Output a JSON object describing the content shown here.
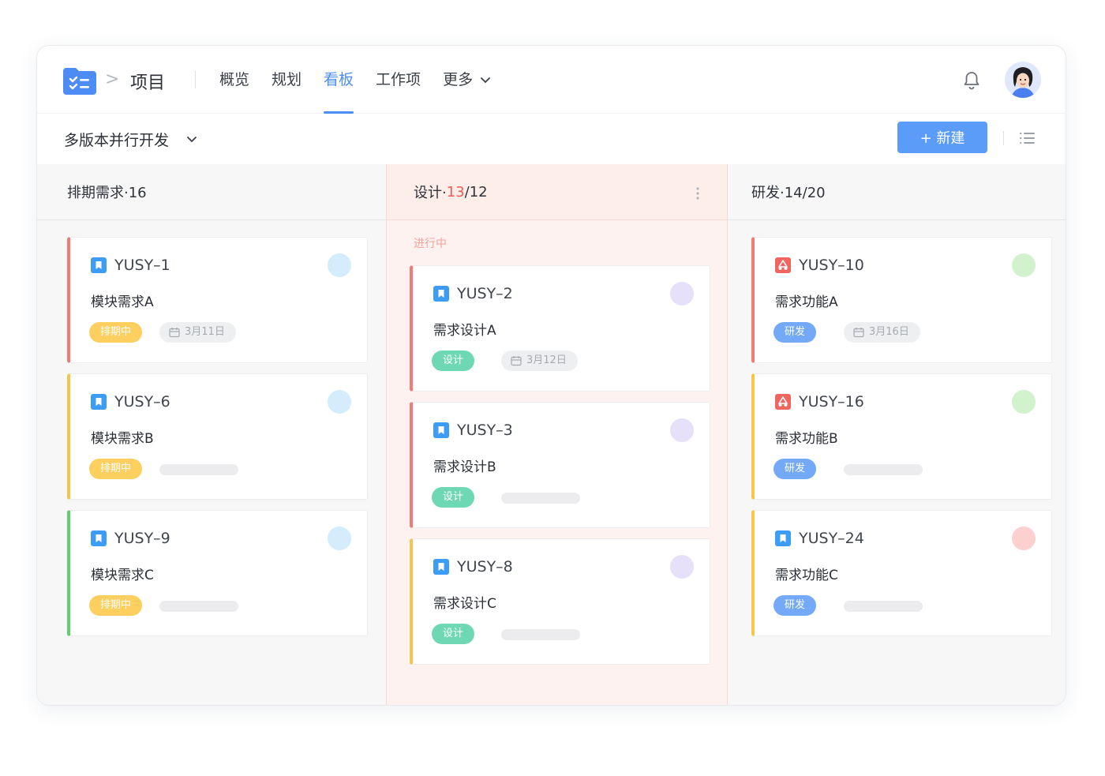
{
  "header": {
    "project_title": "项目",
    "crumb_separator": ">",
    "nav": [
      {
        "label": "概览"
      },
      {
        "label": "规划"
      },
      {
        "label": "看板"
      },
      {
        "label": "工作项"
      },
      {
        "label": "更多"
      }
    ],
    "active_nav": "看板"
  },
  "subbar": {
    "version": "多版本并行开发",
    "new_button": "+ 新建"
  },
  "columns": [
    {
      "title": "排期需求·16",
      "cards": [
        {
          "id": "YUSY–1",
          "title": "模块需求A",
          "tag": "排期中",
          "date": "3月11日"
        },
        {
          "id": "YUSY–6",
          "title": "模块需求B",
          "tag": "排期中"
        },
        {
          "id": "YUSY–9",
          "title": "模块需求C",
          "tag": "排期中"
        }
      ]
    },
    {
      "title_prefix": "设计·",
      "count_current": "13",
      "count_limit": "/12",
      "group_label": "进行中",
      "cards": [
        {
          "id": "YUSY–2",
          "title": "需求设计A",
          "tag": "设计",
          "date": "3月12日"
        },
        {
          "id": "YUSY–3",
          "title": "需求设计B",
          "tag": "设计"
        },
        {
          "id": "YUSY–8",
          "title": "需求设计C",
          "tag": "设计"
        }
      ]
    },
    {
      "title": "研发·14/20",
      "cards": [
        {
          "id": "YUSY–10",
          "title": "需求功能A",
          "tag": "研发",
          "date": "3月16日"
        },
        {
          "id": "YUSY–16",
          "title": "需求功能B",
          "tag": "研发"
        },
        {
          "id": "YUSY–24",
          "title": "需求功能C",
          "tag": "研发"
        }
      ]
    }
  ],
  "colors": {
    "accent": "#4c8df6",
    "tag_scheduled": "#fccf5e",
    "tag_design": "#6ed8b4",
    "tag_dev": "#73a9f7",
    "limit_exceeded": "#f25c54"
  }
}
